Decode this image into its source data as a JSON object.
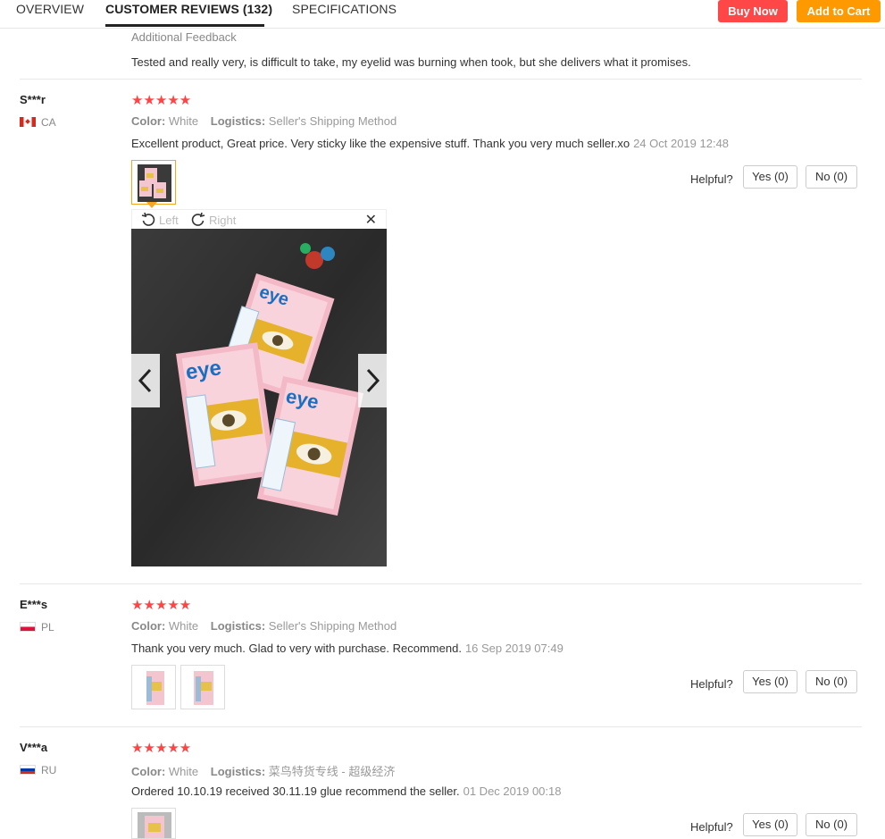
{
  "tabs": {
    "overview": "OVERVIEW",
    "reviews": "CUSTOMER REVIEWS (132)",
    "specifications": "SPECIFICATIONS"
  },
  "actions": {
    "buy_now": "Buy Now",
    "add_to_cart": "Add to Cart"
  },
  "additional_feedback": {
    "title": "Additional Feedback",
    "text": "Tested and really very, is difficult to take, my eyelid was burning when took, but she delivers what it promises."
  },
  "labels": {
    "color": "Color:",
    "logistics": "Logistics:",
    "helpful": "Helpful?",
    "rotate_left": "Left",
    "rotate_right": "Right"
  },
  "reviews": [
    {
      "user": "S***r",
      "country": "CA",
      "stars": "★★★★★",
      "color": "White",
      "logistics": "Seller's Shipping Method",
      "text": "Excellent product, Great price. Very sticky like the expensive stuff. Thank you very much seller.xo",
      "date": "24 Oct 2019 12:48",
      "yes": "Yes (0)",
      "no": "No (0)"
    },
    {
      "user": "E***s",
      "country": "PL",
      "stars": "★★★★★",
      "color": "White",
      "logistics": "Seller's Shipping Method",
      "text": "Thank you very much. Glad to very with purchase. Recommend.",
      "date": "16 Sep 2019 07:49",
      "yes": "Yes (0)",
      "no": "No (0)"
    },
    {
      "user": "V***a",
      "country": "RU",
      "stars": "★★★★★",
      "color": "White",
      "logistics": "菜鸟特货专线 - 超级经济",
      "text": "Ordered 10.10.19 received 30.11.19 glue recommend the seller.",
      "date": "01 Dec 2019 00:18",
      "yes": "Yes (0)",
      "no": "No (0)"
    }
  ],
  "colors": {
    "buy_now": "#ff4747",
    "add_to_cart": "#ff9900",
    "stars": "#ff4444",
    "selected_thumb": "#f5a623"
  }
}
